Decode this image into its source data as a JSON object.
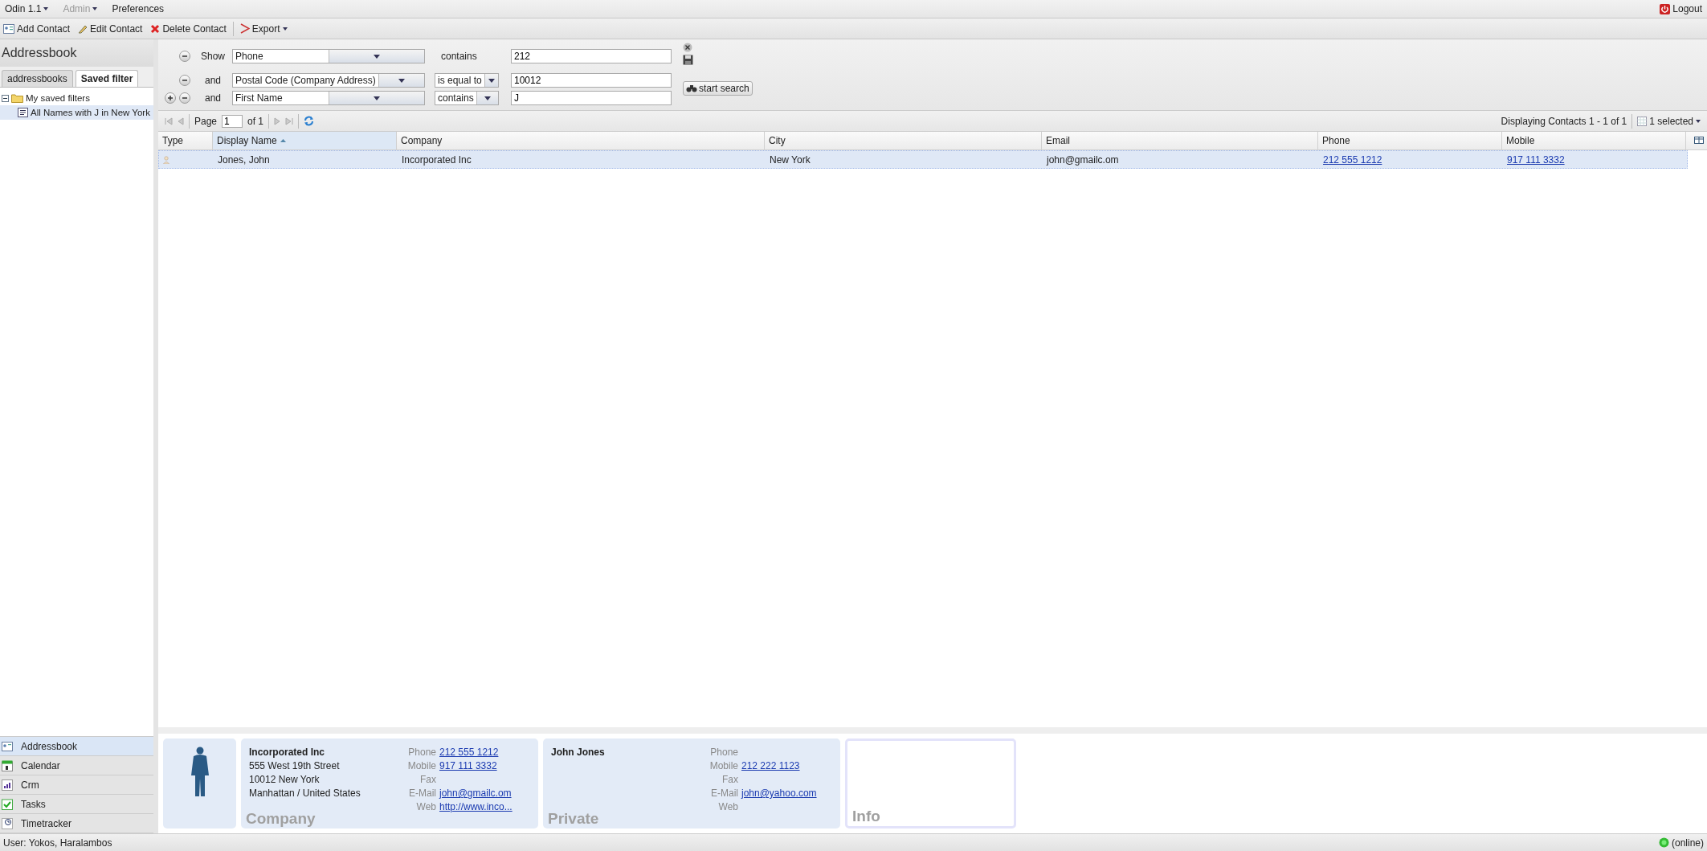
{
  "menu": [
    {
      "label": "Odin 1.1",
      "dropdown": true,
      "disabled": false
    },
    {
      "label": "Admin",
      "dropdown": true,
      "disabled": true
    },
    {
      "label": "Preferences",
      "dropdown": false,
      "disabled": false
    }
  ],
  "logout": "Logout",
  "toolbar": [
    {
      "kind": "add",
      "label": "Add Contact",
      "dropdown": false
    },
    {
      "kind": "edit",
      "label": "Edit Contact",
      "dropdown": false
    },
    {
      "kind": "delete",
      "label": "Delete Contact",
      "dropdown": false
    },
    {
      "kind": "export",
      "label": "Export",
      "dropdown": true
    }
  ],
  "sidebar": {
    "title": "Addressbook",
    "tabs": [
      {
        "label": "addressbooks",
        "selected": false
      },
      {
        "label": "Saved filter",
        "selected": true
      }
    ],
    "tree": [
      {
        "label": "My saved filters",
        "expanded": true,
        "selected": false,
        "children": [
          {
            "label": "All Names with J in New York",
            "selected": true
          }
        ]
      }
    ]
  },
  "filters": [
    {
      "add": false,
      "conjunction": "Show",
      "field": "Phone",
      "operator": "contains",
      "operator_dropdown": false,
      "value": "212"
    },
    {
      "add": false,
      "conjunction": "and",
      "field": "Postal Code (Company Address)",
      "operator": "is equal to",
      "operator_dropdown": true,
      "value": "10012"
    },
    {
      "add": true,
      "conjunction": "and",
      "field": "First Name",
      "operator": "contains",
      "operator_dropdown": true,
      "value": "J"
    }
  ],
  "search_button": "start search",
  "paging": {
    "page_label": "Page",
    "page": "1",
    "of": "of 1",
    "display": "Displaying Contacts 1 - 1 of 1",
    "selection": "1 selected"
  },
  "grid": {
    "columns": [
      {
        "label": "Type",
        "sorted": false
      },
      {
        "label": "Display Name",
        "sorted": true
      },
      {
        "label": "Company",
        "sorted": false
      },
      {
        "label": "City",
        "sorted": false
      },
      {
        "label": "Email",
        "sorted": false
      },
      {
        "label": "Phone",
        "sorted": false
      },
      {
        "label": "Mobile",
        "sorted": false
      }
    ],
    "rows": [
      {
        "selected": true,
        "cells": [
          {
            "kind": "icon"
          },
          {
            "kind": "text",
            "text": "Jones, John"
          },
          {
            "kind": "text",
            "text": "Incorporated Inc"
          },
          {
            "kind": "text",
            "text": "New York"
          },
          {
            "kind": "text",
            "text": "john@gmailc.om"
          },
          {
            "kind": "link",
            "text": "212 555 1212"
          },
          {
            "kind": "link",
            "text": "917 111 3332"
          }
        ]
      }
    ]
  },
  "details": {
    "cards": [
      {
        "title": "Company",
        "heading": "Incorporated Inc",
        "lines": [
          "555 West 19th Street",
          "10012 New York",
          "Manhattan / United States"
        ],
        "fields": [
          {
            "label": "Phone",
            "value": "212 555 1212"
          },
          {
            "label": "Mobile",
            "value": "917 111 3332"
          },
          {
            "label": "Fax"
          },
          {
            "label": "E-Mail",
            "value": "john@gmailc.om"
          },
          {
            "label": "Web",
            "value": "http://www.inco..."
          }
        ]
      },
      {
        "title": "Private",
        "heading": "John Jones",
        "fields": [
          {
            "label": "Phone"
          },
          {
            "label": "Mobile",
            "value": "212 222 1123"
          },
          {
            "label": "Fax"
          },
          {
            "label": "E-Mail",
            "value": "john@yahoo.com"
          },
          {
            "label": "Web"
          }
        ]
      }
    ],
    "info_title": "Info"
  },
  "modules": [
    {
      "kind": "addressbook",
      "label": "Addressbook",
      "selected": true
    },
    {
      "kind": "calendar",
      "label": "Calendar",
      "selected": false
    },
    {
      "kind": "crm",
      "label": "Crm",
      "selected": false
    },
    {
      "kind": "tasks",
      "label": "Tasks",
      "selected": false
    },
    {
      "kind": "timetracker",
      "label": "Timetracker",
      "selected": false
    }
  ],
  "status": {
    "user": "User: Yokos, Haralambos",
    "online": "(online)"
  }
}
